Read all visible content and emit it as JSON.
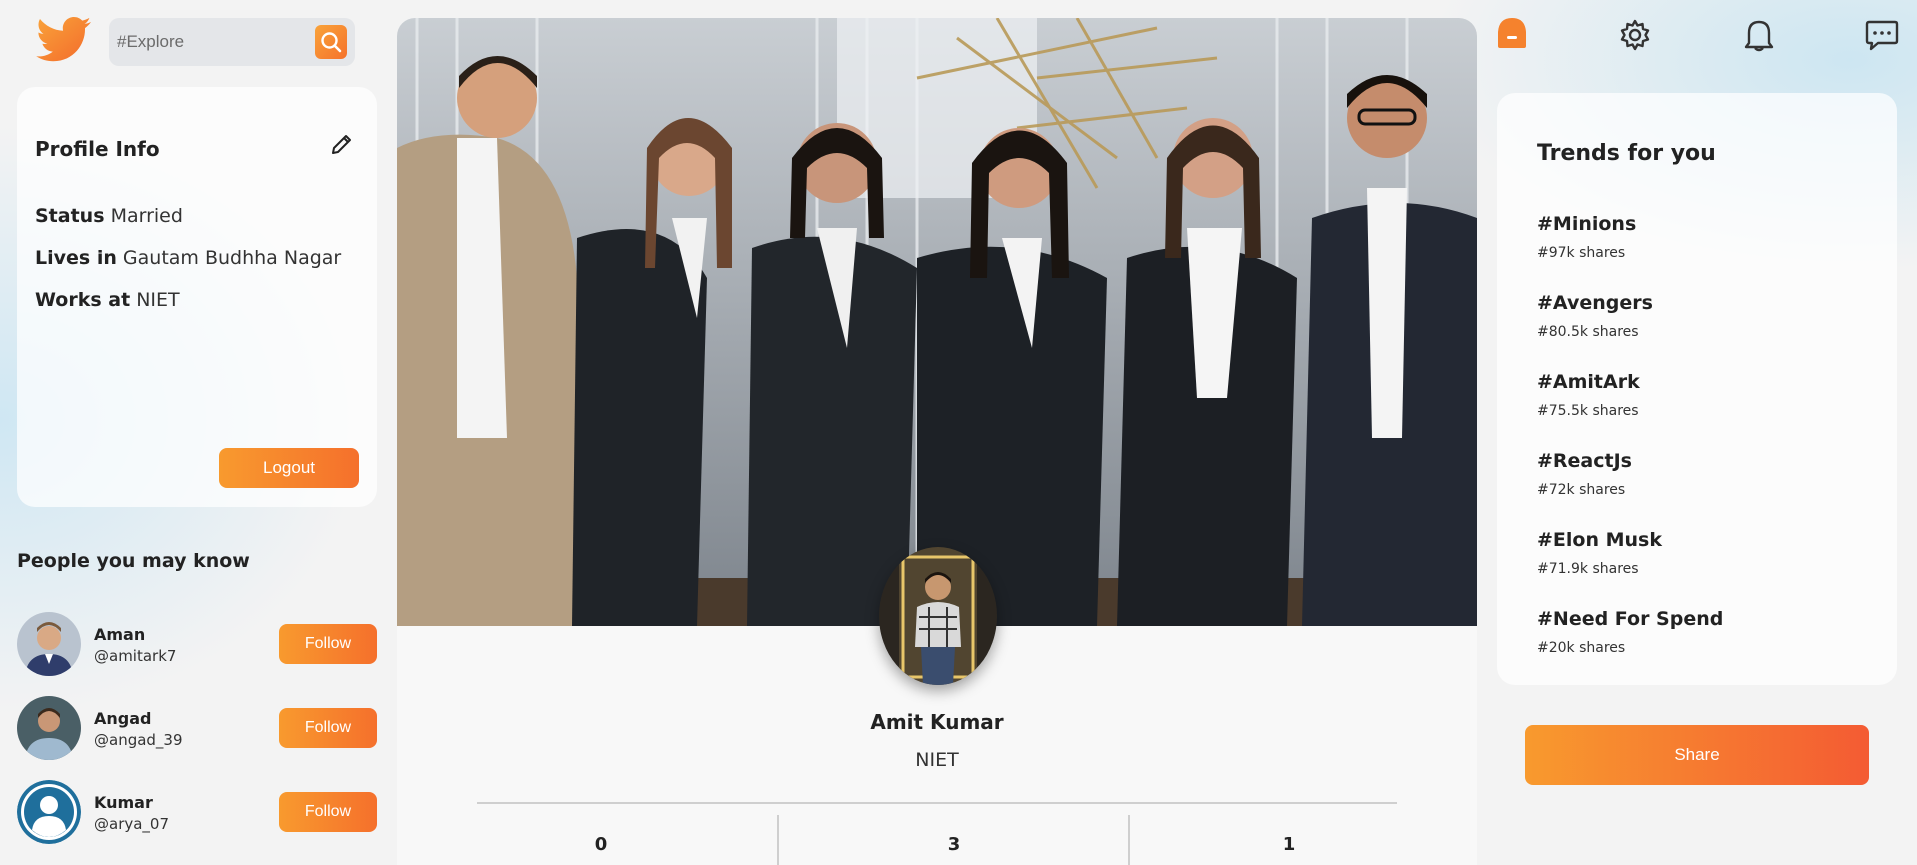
{
  "search": {
    "placeholder": "#Explore"
  },
  "profile_info": {
    "title": "Profile Info",
    "status_label": "Status",
    "status_value": "Married",
    "lives_label": "Lives in",
    "lives_value": "Gautam Budhha Nagar",
    "works_label": "Works at",
    "works_value": "NIET",
    "logout_label": "Logout"
  },
  "people": {
    "title": "People you may know",
    "follow_label": "Follow",
    "items": [
      {
        "name": "Aman",
        "handle": "@amitark7"
      },
      {
        "name": "Angad",
        "handle": "@angad_39"
      },
      {
        "name": "Kumar",
        "handle": "@arya_07"
      }
    ]
  },
  "profile": {
    "name": "Amit Kumar",
    "org": "NIET",
    "stats": [
      "0",
      "3",
      "1"
    ]
  },
  "trends": {
    "title": "Trends for you",
    "items": [
      {
        "tag": "#Minions",
        "shares": "#97k shares"
      },
      {
        "tag": "#Avengers",
        "shares": "#80.5k shares"
      },
      {
        "tag": "#AmitArk",
        "shares": "#75.5k shares"
      },
      {
        "tag": "#ReactJs",
        "shares": "#72k shares"
      },
      {
        "tag": "#Elon Musk",
        "shares": "#71.9k shares"
      },
      {
        "tag": "#Need For Spend",
        "shares": "#20k shares"
      }
    ]
  },
  "share_label": "Share",
  "colors": {
    "accent": "#f5822d",
    "accent_dark": "#f45b33",
    "logo": "#f5822d"
  }
}
